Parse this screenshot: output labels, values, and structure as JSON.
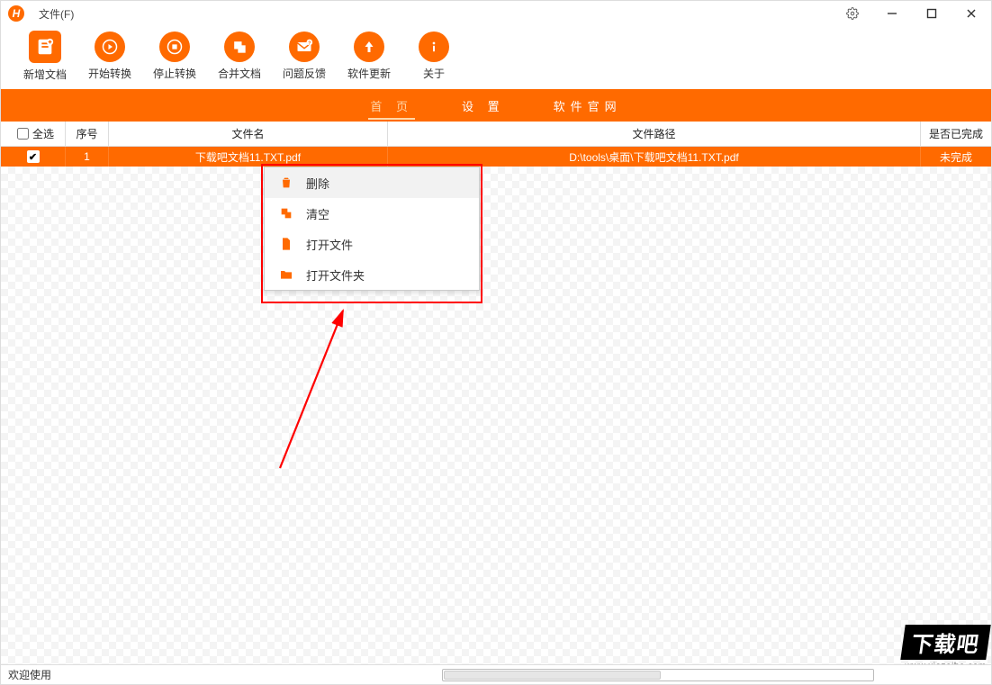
{
  "titlebar": {
    "logo": "H",
    "menu_file": "文件(F)"
  },
  "toolbar": {
    "items": [
      {
        "label": "新增文档"
      },
      {
        "label": "开始转换"
      },
      {
        "label": "停止转换"
      },
      {
        "label": "合并文档"
      },
      {
        "label": "问题反馈"
      },
      {
        "label": "软件更新"
      },
      {
        "label": "关于"
      }
    ]
  },
  "tabs": {
    "home": "首  页",
    "settings": "设  置",
    "website": "软件官网"
  },
  "table": {
    "headers": {
      "select_all": "全选",
      "num": "序号",
      "name": "文件名",
      "path": "文件路径",
      "done": "是否已完成"
    },
    "rows": [
      {
        "checked": true,
        "num": "1",
        "name": "下载吧文档11.TXT.pdf",
        "path": "D:\\tools\\桌面\\下载吧文档11.TXT.pdf",
        "done": "未完成"
      }
    ]
  },
  "context_menu": {
    "items": [
      {
        "label": "删除"
      },
      {
        "label": "清空"
      },
      {
        "label": "打开文件"
      },
      {
        "label": "打开文件夹"
      }
    ]
  },
  "status": {
    "welcome": "欢迎使用"
  },
  "watermark": {
    "text": "下载吧",
    "url": "www.xiazaiba.com"
  },
  "colors": {
    "accent": "#ff6a00"
  }
}
